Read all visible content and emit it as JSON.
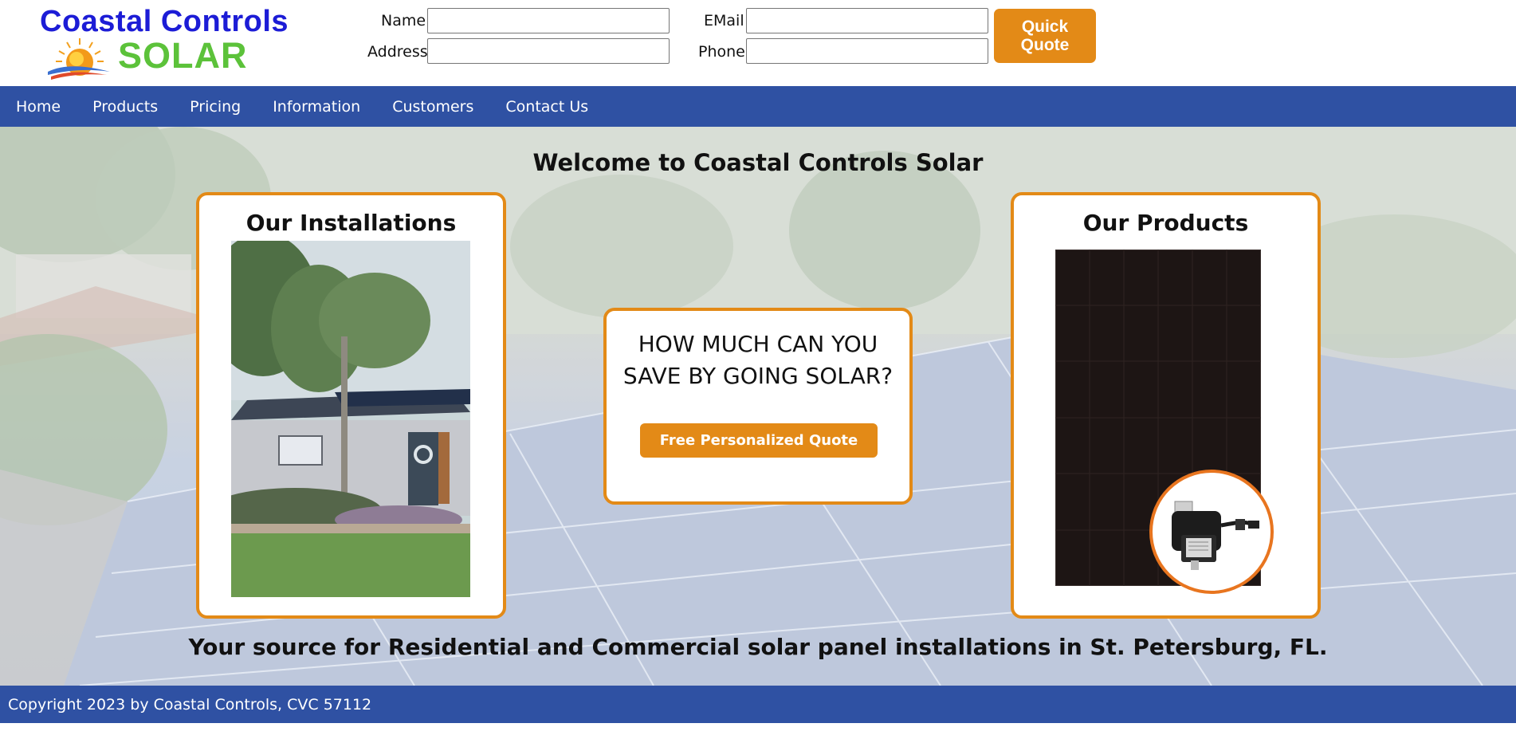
{
  "brand": {
    "name_line1": "Coastal Controls",
    "name_line2": "SOLAR",
    "colors": {
      "blue": "#1c1cd6",
      "green": "#5cc23a",
      "orange": "#e38a17",
      "nav_blue": "#2f51a3"
    }
  },
  "quick_form": {
    "name_label": "Name",
    "email_label": "EMail",
    "address_label": "Address",
    "phone_label": "Phone",
    "name_value": "",
    "email_value": "",
    "address_value": "",
    "phone_value": "",
    "submit_label": "Quick Quote"
  },
  "nav": {
    "items": [
      "Home",
      "Products",
      "Pricing",
      "Information",
      "Customers",
      "Contact Us"
    ]
  },
  "hero": {
    "title": "Welcome to Coastal Controls Solar",
    "tagline": "Your source for Residential and Commercial solar panel installations in St. Petersburg, FL."
  },
  "installations_card": {
    "title": "Our Installations"
  },
  "savings_card": {
    "heading_line1": "HOW MUCH CAN YOU",
    "heading_line2": "SAVE BY GOING SOLAR?",
    "button_label": "Free Personalized Quote"
  },
  "products_card": {
    "title": "Our Products"
  },
  "footer": {
    "copyright": "Copyright 2023 by Coastal Controls, CVC 57112"
  },
  "icons": [
    "sun-logo-icon",
    "solar-panel-image",
    "microinverter-image",
    "house-photo"
  ]
}
